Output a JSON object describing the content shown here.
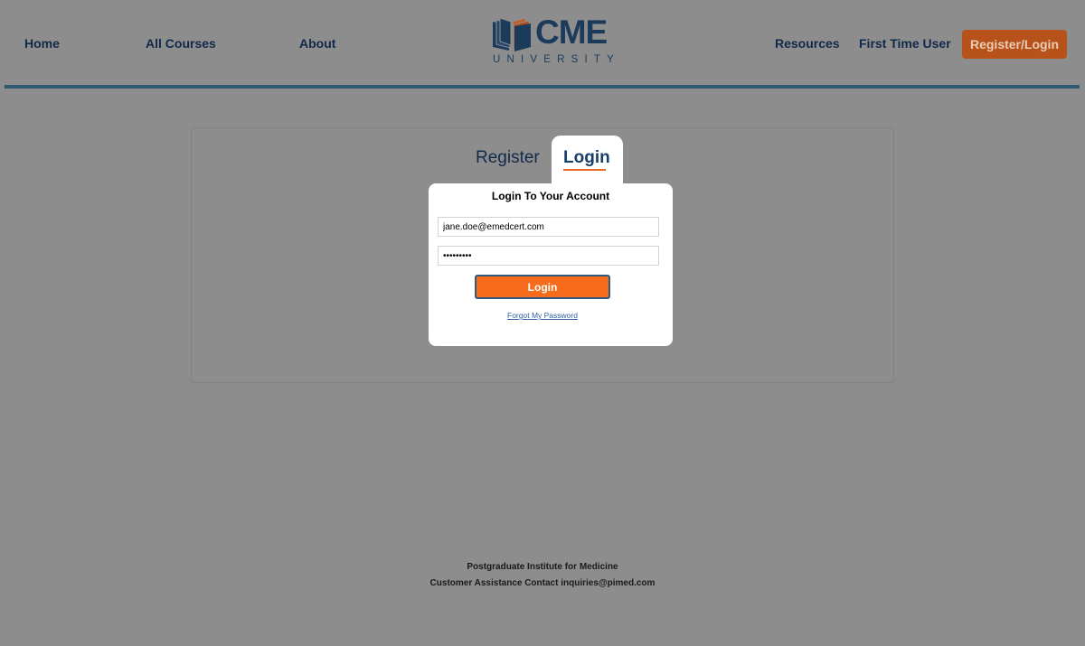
{
  "nav": {
    "home": "Home",
    "all_courses": "All Courses",
    "about": "About",
    "resources": "Resources",
    "first_time_user": "First Time User",
    "register_login": "Register/Login"
  },
  "logo": {
    "main": "CME",
    "sub": "UNIVERSITY"
  },
  "tabs": {
    "register": "Register",
    "login": "Login",
    "active": "Login"
  },
  "login_form": {
    "title": "Login To Your Account",
    "email_value": "jane.doe@emedcert.com",
    "password_value": "•••••••••",
    "login_button": "Login",
    "forgot_password": "Forgot My Password"
  },
  "footer": {
    "line1": "Postgraduate Institute for Medicine",
    "line2": "Customer Assistance Contact inquiries@pimed.com"
  },
  "colors": {
    "background": "#8d8d8d",
    "navy": "#11294a",
    "accent_orange": "#f66b1c",
    "register_button": "#b6521a",
    "header_rule": "#2f5a73"
  },
  "icons": {
    "logo": "open-book-icon"
  }
}
